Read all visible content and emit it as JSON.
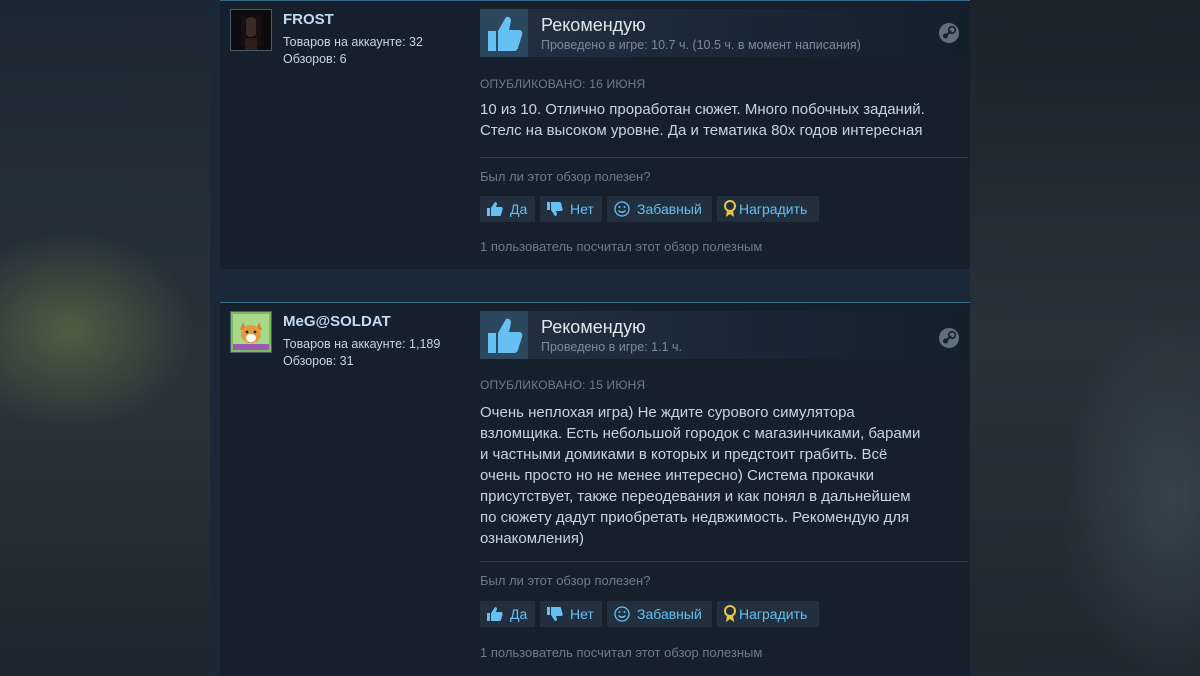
{
  "colors": {
    "page_bg": "#1b2838",
    "review_bg": "#16202d",
    "link_blue": "#66c0f4",
    "thumb_up_blue": "#66c0f4",
    "muted_text": "#6b7c8d",
    "body_text": "#c6d4df"
  },
  "reviews": [
    {
      "author": {
        "name": "FROST",
        "products_label": "Товаров на аккаунте: 32",
        "reviews_label": "Обзоров: 6",
        "avatar_icon": "dark-portrait-avatar"
      },
      "verdict": "Рекомендую",
      "verdict_icon": "thumbs-up-icon",
      "hours": "Проведено в игре: 10.7 ч. (10.5 ч. в момент написания)",
      "posted": "ОПУБЛИКОВАНО: 16 ИЮНЯ",
      "text": "10 из 10. Отлично проработан сюжет. Много побочных заданий. Стелс на высоком уровне. Да и тематика 80х годов интересная",
      "helpful_question": "Был ли этот обзор полезен?",
      "buttons": {
        "yes": "Да",
        "no": "Нет",
        "funny": "Забавный",
        "award": "Наградить"
      },
      "helpful_count": "1 пользователь посчитал этот обзор полезным"
    },
    {
      "author": {
        "name": "MeG@SOLDAT",
        "products_label": "Товаров на аккаунте: 1,189",
        "reviews_label": "Обзоров: 31",
        "avatar_icon": "corgi-avatar"
      },
      "verdict": "Рекомендую",
      "verdict_icon": "thumbs-up-icon",
      "hours": "Проведено в игре: 1.1 ч.",
      "posted": "ОПУБЛИКОВАНО: 15 ИЮНЯ",
      "text_lines": [
        "Очень неплохая игра) Не ждите сурового симулятора",
        "взломщика. Есть небольшой городок с магазинчиками, барами",
        "и частными домиками в которых и предстоит грабить. Всё",
        "очень просто но не менее интересно) Система прокачки",
        "присутствует, также переодевания и как понял в дальнейшем",
        "по сюжету дадут приобретать недвжимость. Рекомендую для",
        "ознакомления)"
      ],
      "helpful_question": "Был ли этот обзор полезен?",
      "buttons": {
        "yes": "Да",
        "no": "Нет",
        "funny": "Забавный",
        "award": "Наградить"
      },
      "helpful_count": "1 пользователь посчитал этот обзор полезным"
    }
  ]
}
